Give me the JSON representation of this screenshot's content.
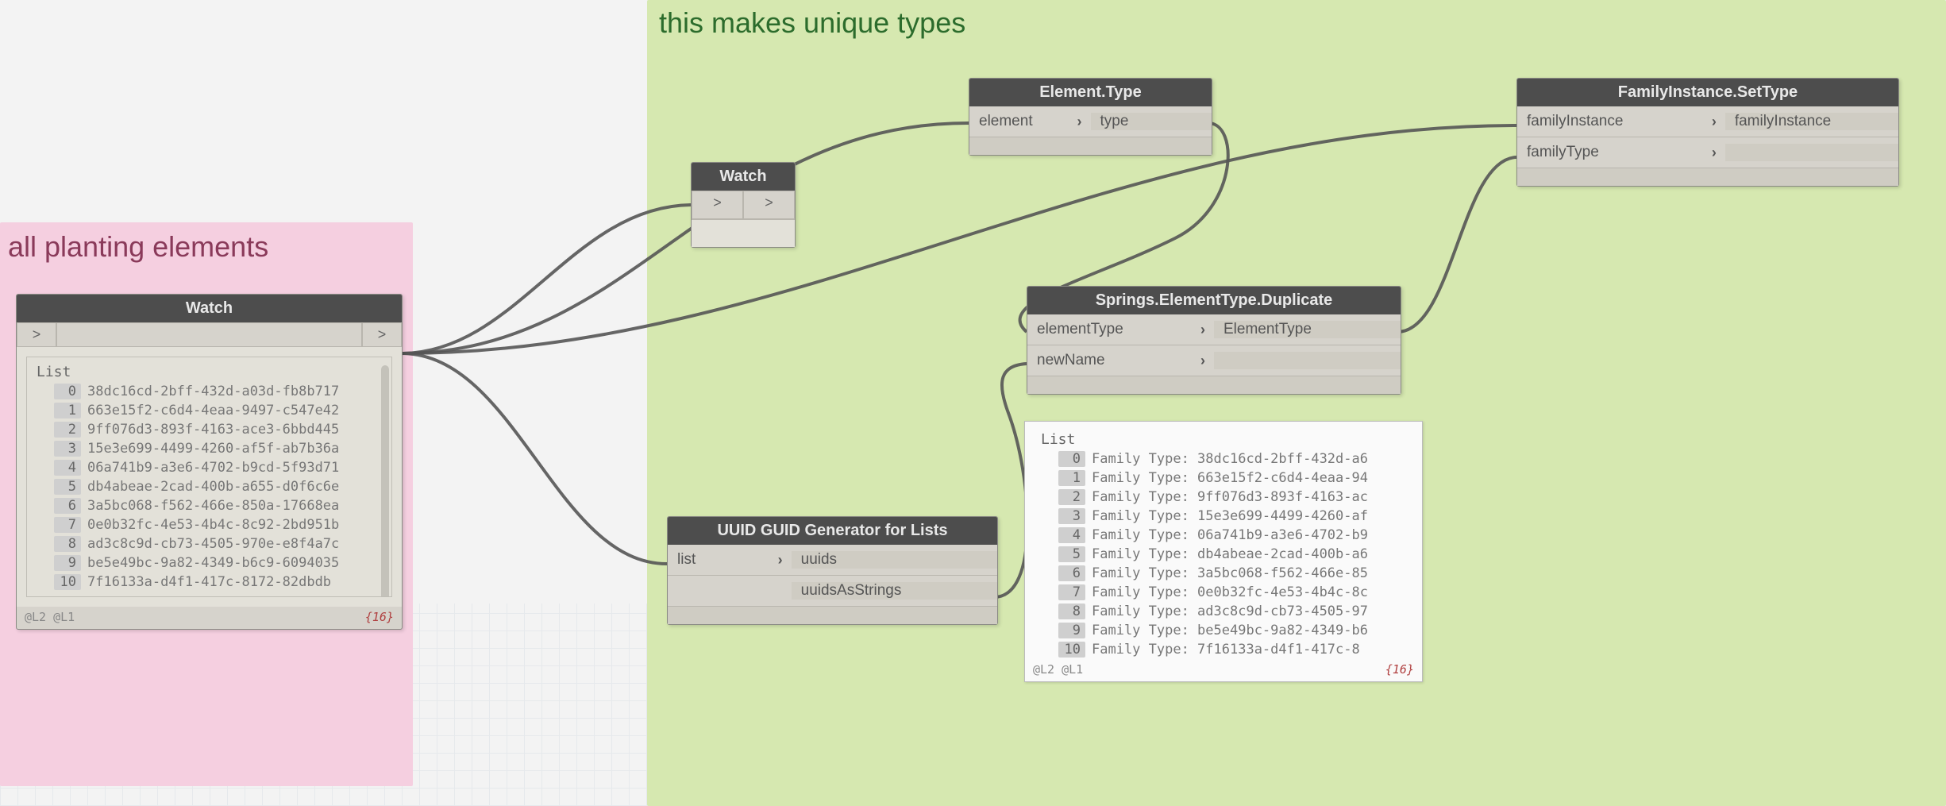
{
  "groups": {
    "pink": {
      "label": "all planting elements"
    },
    "green": {
      "label": "this makes unique types"
    }
  },
  "nodes": {
    "watch_left": {
      "title": "Watch",
      "levels": "@L2 @L1",
      "count": "{16}",
      "list_header": "List",
      "items": [
        "38dc16cd-2bff-432d-a03d-fb8b717",
        "663e15f2-c6d4-4eaa-9497-c547e42",
        "9ff076d3-893f-4163-ace3-6bbd445",
        "15e3e699-4499-4260-af5f-ab7b36a",
        "06a741b9-a3e6-4702-b9cd-5f93d71",
        "db4abeae-2cad-400b-a655-d0f6c6e",
        "3a5bc068-f562-466e-850a-17668ea",
        "0e0b32fc-4e53-4b4c-8c92-2bd951b",
        "ad3c8c9d-cb73-4505-970e-e8f4a7c",
        "be5e49bc-9a82-4349-b6c9-6094035",
        "7f16133a-d4f1-417c-8172-82dbdb"
      ]
    },
    "watch_small": {
      "title": "Watch"
    },
    "element_type": {
      "title": "Element.Type",
      "in": [
        "element"
      ],
      "out": [
        "type"
      ]
    },
    "springs_dup": {
      "title": "Springs.ElementType.Duplicate",
      "in": [
        "elementType",
        "newName"
      ],
      "out": [
        "ElementType"
      ]
    },
    "uuid": {
      "title": "UUID GUID Generator for Lists",
      "in": [
        "list"
      ],
      "out": [
        "uuids",
        "uuidsAsStrings"
      ]
    },
    "family_set": {
      "title": "FamilyInstance.SetType",
      "in": [
        "familyInstance",
        "familyType"
      ],
      "out": [
        "familyInstance"
      ]
    }
  },
  "preview_dup": {
    "list_header": "List",
    "levels": "@L2 @L1",
    "count": "{16}",
    "items": [
      "Family Type: 38dc16cd-2bff-432d-a6",
      "Family Type: 663e15f2-c6d4-4eaa-94",
      "Family Type: 9ff076d3-893f-4163-ac",
      "Family Type: 15e3e699-4499-4260-af",
      "Family Type: 06a741b9-a3e6-4702-b9",
      "Family Type: db4abeae-2cad-400b-a6",
      "Family Type: 3a5bc068-f562-466e-85",
      "Family Type: 0e0b32fc-4e53-4b4c-8c",
      "Family Type: ad3c8c9d-cb73-4505-97",
      "Family Type: be5e49bc-9a82-4349-b6",
      "Family Type: 7f16133a-d4f1-417c-8"
    ]
  }
}
